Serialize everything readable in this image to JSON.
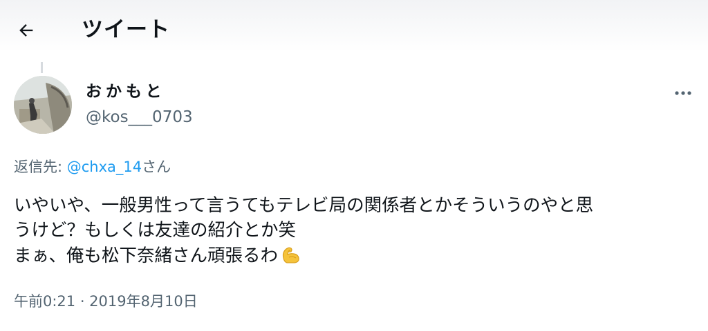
{
  "header": {
    "title": "ツイート",
    "back_icon": "arrow-left-icon"
  },
  "tweet": {
    "author": {
      "display_name": "おかもと",
      "username": "@kos___0703",
      "avatar_icon": "user-avatar-photo"
    },
    "more_icon": "more-horizontal-icon",
    "reply_prefix": "返信先: ",
    "reply_mention": "@chxa_14",
    "reply_suffix": "さん",
    "text_lines": [
      "いやいや、一般男性って言うてもテレビ局の関係者とかそういうのやと思",
      "うけど？もしくは友達の紹介とか笑",
      "まぁ、俺も松下奈緒さん頑張るわ"
    ],
    "emoji": "flexed-biceps-emoji",
    "timestamp": "午前0:21 · 2019年8月10日"
  },
  "colors": {
    "text_primary": "#0f1419",
    "text_secondary": "#536471",
    "link": "#1d9bf0",
    "emoji_yellow": "#f5c33b"
  }
}
